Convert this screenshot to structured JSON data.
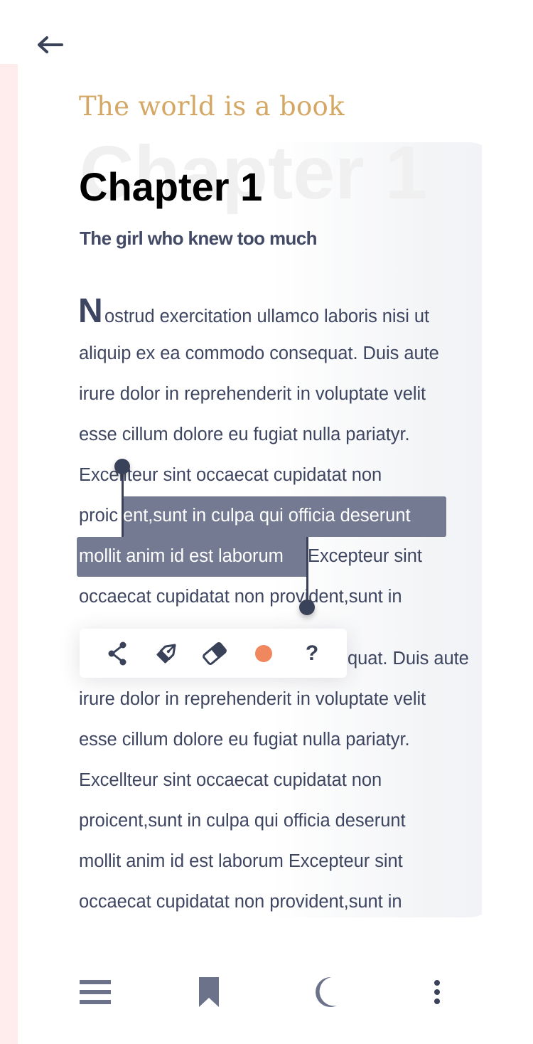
{
  "header": {
    "back_icon": "arrow-left-icon"
  },
  "book": {
    "title": "The world is a book",
    "chapter_watermark": "Chapter 1",
    "chapter_title": "Chapter 1",
    "chapter_subtitle": "The girl who knew too much"
  },
  "body": {
    "drop_cap": "N",
    "lines": [
      "ostrud exercitation ullamco laboris nisi ut",
      "aliquip ex ea commodo consequat. Duis aute",
      "irure dolor in reprehenderit in voluptate velit",
      "esse cillum dolore eu fugiat nulla pariatyr.",
      "Excellteur sint occaecat cupidatat non",
      "proicent,sunt in culpa qui officia deserunt",
      "mollit anim id est laborum Excepteur sint",
      "occaecat cupidatat non provident,sunt in",
      "aliquip ex ea commodo consequat. Duis aute",
      "irure dolor in reprehenderit in voluptate velit",
      "esse cillum dolore eu fugiat nulla pariatyr.",
      "Excellteur sint occaecat cupidatat non",
      "proicent,sunt in culpa qui officia deserunt",
      "mollit anim id est laborum Excepteur sint",
      "occaecat cupidatat non provident,sunt in"
    ],
    "selection": {
      "line1_prefix": "proic",
      "line1_selected": "ent,sunt in culpa qui officia deserunt",
      "line2_selected": "mollit anim id est laborum",
      "line2_suffix": " Excepteur sint"
    },
    "line9_visible": "quat. Duis aute"
  },
  "selection_toolbar": {
    "share_icon": "share-icon",
    "pen_icon": "pen-icon",
    "eraser_icon": "eraser-icon",
    "highlight_color": "#f0875e",
    "help_label": "?"
  },
  "bottom_nav": {
    "menu_icon": "menu-icon",
    "bookmark_icon": "bookmark-icon",
    "night_mode_icon": "moon-icon",
    "more_icon": "more-vertical-icon"
  },
  "colors": {
    "accent_gold": "#d4a864",
    "text_dark": "#3e4560",
    "selection": "#737a91",
    "icon": "#6b7289"
  }
}
